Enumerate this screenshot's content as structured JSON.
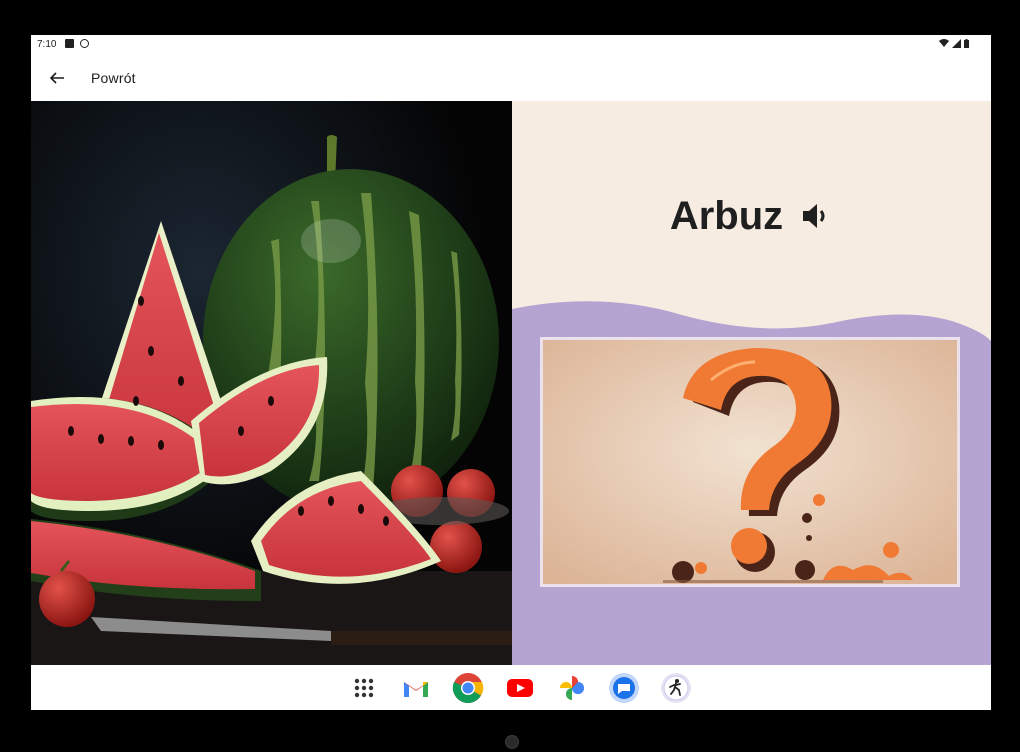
{
  "status_bar": {
    "time": "7:10"
  },
  "header": {
    "back_label": "Powrót"
  },
  "word_card": {
    "word": "Arbuz"
  },
  "taskbar": {
    "apps": [
      "app-drawer",
      "gmail",
      "chrome",
      "youtube",
      "photos",
      "messages",
      "kids-app"
    ]
  },
  "colors": {
    "word_panel_bg": "#f6ece2",
    "purple_band": "#b5a3d2",
    "question_mark": "#f07a34"
  }
}
